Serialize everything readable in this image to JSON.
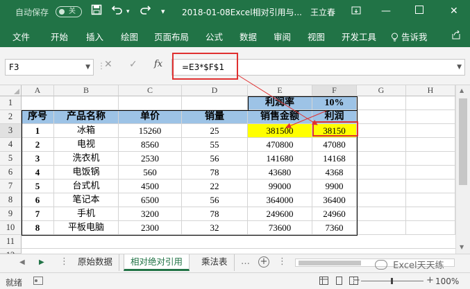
{
  "titlebar": {
    "autosave_label": "自动保存",
    "autosave_state": "关",
    "save_icon": "save-icon",
    "undo_icon": "undo-icon",
    "doc_title": "2018-01-08Excel相对引用与...",
    "user_name": "王立春"
  },
  "ribbon": {
    "tabs": [
      "文件",
      "开始",
      "插入",
      "绘图",
      "页面布局",
      "公式",
      "数据",
      "审阅",
      "视图",
      "开发工具"
    ],
    "tell_me": "告诉我"
  },
  "formula_bar": {
    "name_box": "F3",
    "fx_label": "fx",
    "formula": "=E3*$F$1"
  },
  "columns": [
    "A",
    "B",
    "C",
    "D",
    "E",
    "F",
    "G",
    "H"
  ],
  "rows": [
    "1",
    "2",
    "3",
    "4",
    "5",
    "6",
    "7",
    "8",
    "9",
    "10",
    "11",
    "12"
  ],
  "sheet": {
    "r1": {
      "E": "利润率",
      "F": "10%"
    },
    "headers": [
      "序号",
      "产品名称",
      "单价",
      "销量",
      "销售金额",
      "利润"
    ],
    "data": [
      [
        "1",
        "冰箱",
        "15260",
        "25",
        "381500",
        "38150"
      ],
      [
        "2",
        "电视",
        "8560",
        "55",
        "470800",
        "47080"
      ],
      [
        "3",
        "洗衣机",
        "2530",
        "56",
        "141680",
        "14168"
      ],
      [
        "4",
        "电饭锅",
        "560",
        "78",
        "43680",
        "4368"
      ],
      [
        "5",
        "台式机",
        "4500",
        "22",
        "99000",
        "9900"
      ],
      [
        "6",
        "笔记本",
        "6500",
        "56",
        "364000",
        "36400"
      ],
      [
        "7",
        "手机",
        "3200",
        "78",
        "249600",
        "24960"
      ],
      [
        "8",
        "平板电脑",
        "2300",
        "32",
        "73600",
        "7360"
      ]
    ]
  },
  "sheet_tabs": [
    "原始数据",
    "相对绝对引用",
    "乘法表"
  ],
  "active_sheet": "相对绝对引用",
  "watermark": "Excel天天练",
  "status": {
    "ready": "就绪",
    "zoom": "100%"
  },
  "colors": {
    "excel_green": "#217346",
    "header_blue": "#9dc3e6",
    "highlight_yellow": "#ffff00",
    "annotation_red": "#e03030"
  }
}
